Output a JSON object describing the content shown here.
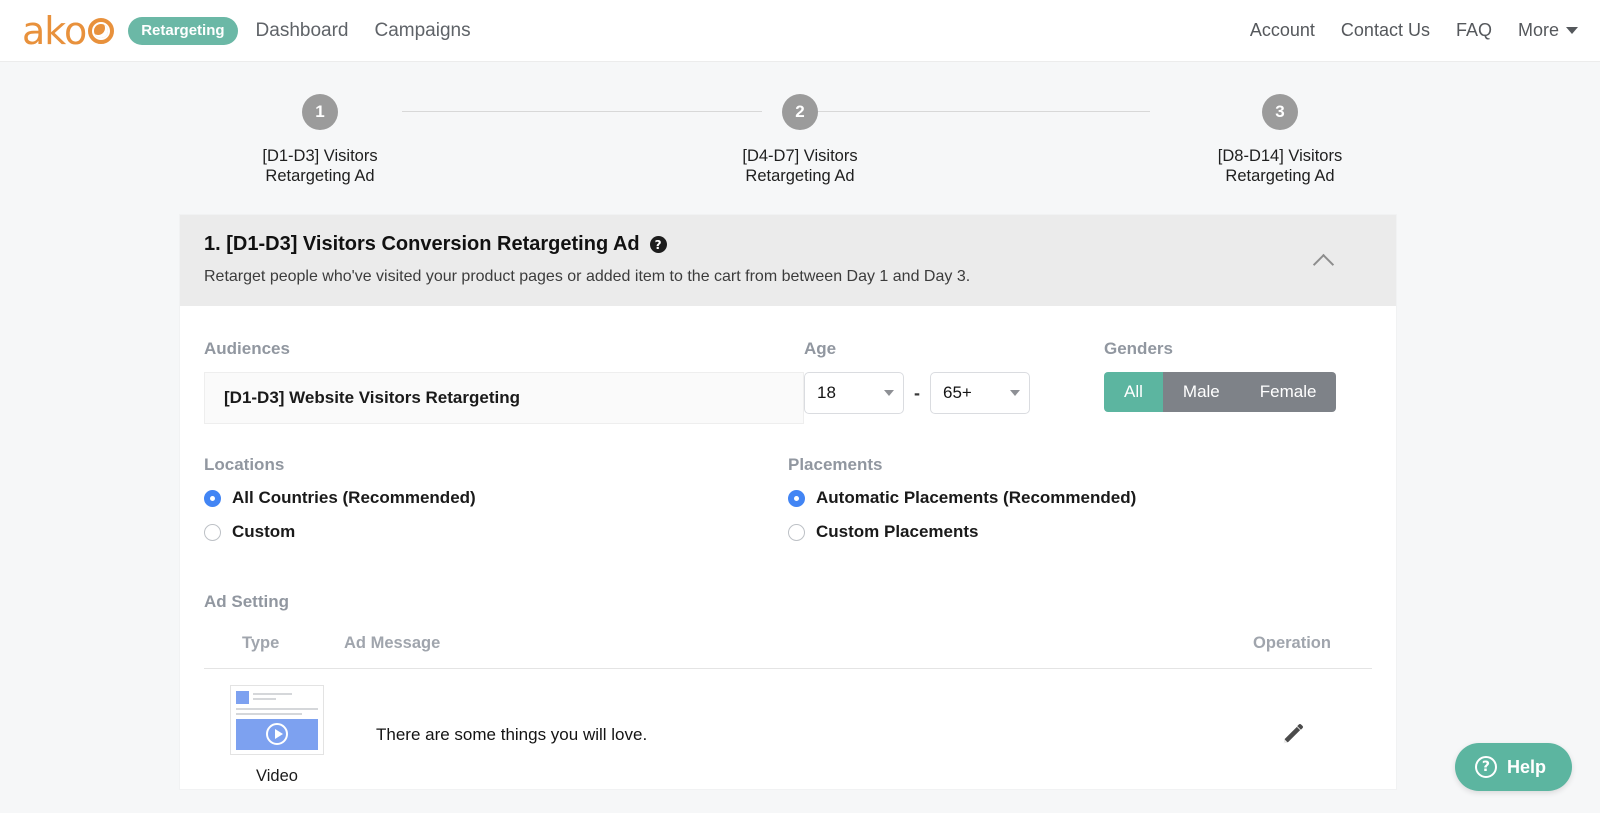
{
  "brand": {
    "logo_text": "ako",
    "logo_color": "#e8913c",
    "badge": "Retargeting",
    "badge_color": "#6bb8a6"
  },
  "navbar": {
    "left_links": [
      {
        "label": "Dashboard"
      },
      {
        "label": "Campaigns"
      }
    ],
    "right_links": [
      {
        "label": "Account"
      },
      {
        "label": "Contact Us"
      },
      {
        "label": "FAQ"
      }
    ],
    "more_label": "More",
    "more_icon": "chevron-down-icon"
  },
  "stepper": {
    "steps": [
      {
        "number": "1",
        "line1": "[D1-D3] Visitors",
        "line2": "Retargeting Ad"
      },
      {
        "number": "2",
        "line1": "[D4-D7] Visitors",
        "line2": "Retargeting Ad"
      },
      {
        "number": "3",
        "line1": "[D8-D14] Visitors",
        "line2": "Retargeting Ad"
      }
    ],
    "circle_color": "#9b9b9b"
  },
  "panel": {
    "title": "1. [D1-D3] Visitors Conversion Retargeting Ad",
    "title_help_icon": "help-circle-icon",
    "title_help_glyph": "?",
    "subtitle": "Retarget people who've visited your product pages or added item to the cart from between Day 1 and Day 3.",
    "collapse_icon": "chevron-up-icon"
  },
  "audiences": {
    "label": "Audiences",
    "value": "[D1-D3] Website Visitors Retargeting"
  },
  "age": {
    "label": "Age",
    "min_value": "18",
    "max_value": "65+",
    "separator": "-",
    "caret_icon": "caret-down-icon"
  },
  "genders": {
    "label": "Genders",
    "options": [
      {
        "label": "All",
        "selected": true
      },
      {
        "label": "Male",
        "selected": false
      },
      {
        "label": "Female",
        "selected": false
      }
    ],
    "active_color": "#5cb5a0",
    "inactive_color": "#7e8288"
  },
  "locations": {
    "label": "Locations",
    "options": [
      {
        "label": "All Countries (Recommended)",
        "selected": true
      },
      {
        "label": "Custom",
        "selected": false
      }
    ],
    "radio_color": "#4285f4"
  },
  "placements": {
    "label": "Placements",
    "options": [
      {
        "label": "Automatic Placements (Recommended)",
        "selected": true
      },
      {
        "label": "Custom Placements",
        "selected": false
      }
    ],
    "radio_color": "#4285f4"
  },
  "ad_setting": {
    "label": "Ad Setting",
    "columns": [
      "Type",
      "Ad Message",
      "Operation"
    ],
    "rows": [
      {
        "type": "Video",
        "thumbnail_icon": "video-ad-preview-icon",
        "play_icon": "play-icon",
        "message": "There are some things you will love.",
        "operation_icon": "edit-pencil-icon"
      }
    ]
  },
  "help_widget": {
    "label": "Help",
    "icon": "help-circle-icon",
    "glyph": "?",
    "color": "#5cb5a0"
  }
}
